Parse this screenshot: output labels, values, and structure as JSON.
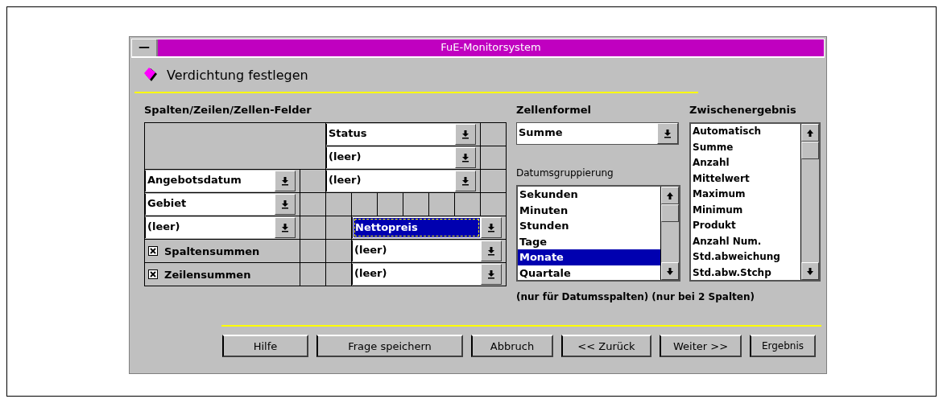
{
  "window": {
    "title": "FuE-Monitorsystem",
    "system_menu": "—"
  },
  "header": {
    "title": "Verdichtung festlegen"
  },
  "fields_panel": {
    "label": "Spalten/Zeilen/Zellen-Felder",
    "column_fields": [
      {
        "value": "Status",
        "selected": false
      },
      {
        "value": "(leer)",
        "selected": false
      },
      {
        "value": "(leer)",
        "selected": false
      }
    ],
    "row_fields": [
      {
        "value": "Angebotsdatum",
        "selected": false
      },
      {
        "value": "Gebiet",
        "selected": false
      },
      {
        "value": "(leer)",
        "selected": false
      }
    ],
    "cell_fields": [
      {
        "value": "Nettopreis",
        "selected": true
      },
      {
        "value": "(leer)",
        "selected": false
      },
      {
        "value": "(leer)",
        "selected": false
      }
    ],
    "checkboxes": [
      {
        "label": "Spaltensummen",
        "checked": true
      },
      {
        "label": "Zeilensummen",
        "checked": true
      }
    ]
  },
  "cell_formula": {
    "label": "Zellenformel",
    "value": "Summe"
  },
  "date_grouping": {
    "label": "Datumsgruppierung",
    "items": [
      {
        "label": "Sekunden",
        "selected": false
      },
      {
        "label": "Minuten",
        "selected": false
      },
      {
        "label": "Stunden",
        "selected": false
      },
      {
        "label": "Tage",
        "selected": false
      },
      {
        "label": "Monate",
        "selected": true
      },
      {
        "label": "Quartale",
        "selected": false
      }
    ],
    "note": "(nur für Datumsspalten)"
  },
  "subtotal": {
    "label": "Zwischenergebnis",
    "items": [
      {
        "label": "Automatisch",
        "selected": false
      },
      {
        "label": "Summe",
        "selected": false
      },
      {
        "label": "Anzahl",
        "selected": false
      },
      {
        "label": "Mittelwert",
        "selected": false
      },
      {
        "label": "Maximum",
        "selected": false
      },
      {
        "label": "Minimum",
        "selected": false
      },
      {
        "label": "Produkt",
        "selected": false
      },
      {
        "label": "Anzahl Num.",
        "selected": false
      },
      {
        "label": "Std.abweichung",
        "selected": false
      },
      {
        "label": "Std.abw.Stchp",
        "selected": false
      }
    ],
    "note": "(nur bei 2 Spalten)"
  },
  "buttons": [
    "Hilfe",
    "Frage speichern",
    "Abbruch",
    "<< Zurück",
    "Weiter >>",
    "Ergebnis"
  ]
}
